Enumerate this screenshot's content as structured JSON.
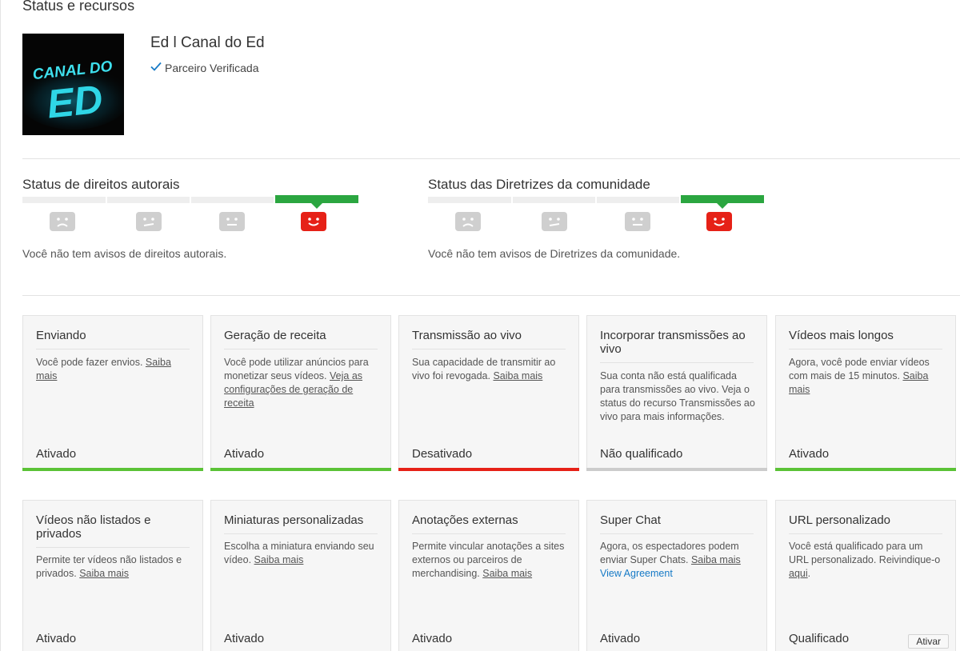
{
  "page_title": "Status e recursos",
  "channel": {
    "name": "Ed l Canal do Ed",
    "avatar_text_top": "CANAL DO",
    "avatar_text_bottom": "ED",
    "verified_label": "Parceiro Verificada"
  },
  "copyright": {
    "title": "Status de direitos autorais",
    "note": "Você não tem avisos de direitos autorais."
  },
  "community": {
    "title": "Status das Diretrizes da comunidade",
    "note": "Você não tem avisos de Diretrizes da comunidade."
  },
  "colors": {
    "green": "#2ba640",
    "red": "#e62117",
    "grey": "#cfcfcf",
    "link_blue": "#167ac6"
  },
  "features": [
    {
      "title": "Enviando",
      "text": "Você pode fazer envios.",
      "link": "Saiba mais",
      "status": "Ativado",
      "state": "enabled"
    },
    {
      "title": "Geração de receita",
      "text": "Você pode utilizar anúncios para monetizar seus vídeos.",
      "link": "Veja as configurações de geração de receita",
      "status": "Ativado",
      "state": "enabled"
    },
    {
      "title": "Transmissão ao vivo",
      "text": "Sua capacidade de transmitir ao vivo foi revogada.",
      "link": "Saiba mais",
      "status": "Desativado",
      "state": "disabled"
    },
    {
      "title": "Incorporar transmissões ao vivo",
      "text": "Sua conta não está qualificada para transmissões ao vivo. Veja o status do recurso Transmissões ao vivo para mais informações.",
      "status": "Não qualificado",
      "state": "ineligible"
    },
    {
      "title": "Vídeos mais longos",
      "text": "Agora, você pode enviar vídeos com mais de 15 minutos.",
      "link": "Saiba mais",
      "status": "Ativado",
      "state": "enabled"
    },
    {
      "title": "Vídeos não listados e privados",
      "text": "Permite ter vídeos não listados e privados.",
      "link": "Saiba mais",
      "status": "Ativado"
    },
    {
      "title": "Miniaturas personalizadas",
      "text": "Escolha a miniatura enviando seu vídeo.",
      "link": "Saiba mais",
      "status": "Ativado"
    },
    {
      "title": "Anotações externas",
      "text": "Permite vincular anotações a sites externos ou parceiros de merchandising.",
      "link": "Saiba mais",
      "status": "Ativado"
    },
    {
      "title": "Super Chat",
      "text": "Agora, os espectadores podem enviar Super Chats.",
      "link": "Saiba mais",
      "extra_link": "View Agreement",
      "status": "Ativado"
    },
    {
      "title": "URL personalizado",
      "text": "Você está qualificado para um URL personalizado. Reivindique-o",
      "link": "aqui",
      "tail": ".",
      "status": "Qualificado",
      "button": "Ativar"
    }
  ]
}
